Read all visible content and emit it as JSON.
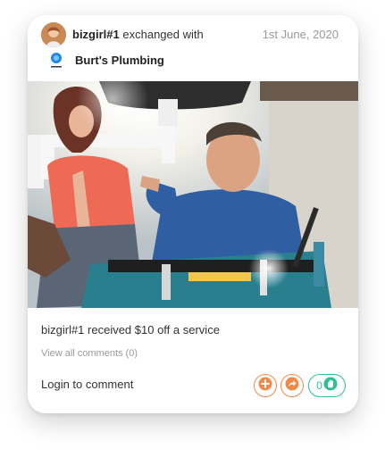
{
  "post": {
    "username": "bizgirl#1",
    "action_text": "exchanged with",
    "date": "1st June, 2020",
    "business_name": "Burt's Plumbing",
    "caption": "bizgirl#1 received $10 off a service",
    "comments_link": "View all comments (0)",
    "login_prompt": "Login to comment",
    "like_count": "0"
  },
  "icons": {
    "add": "plus-icon",
    "share": "share-arrow-icon",
    "like": "hands-icon"
  },
  "colors": {
    "accent_orange": "#f08a4b",
    "accent_green": "#2fbf94",
    "muted_text": "#999999"
  }
}
